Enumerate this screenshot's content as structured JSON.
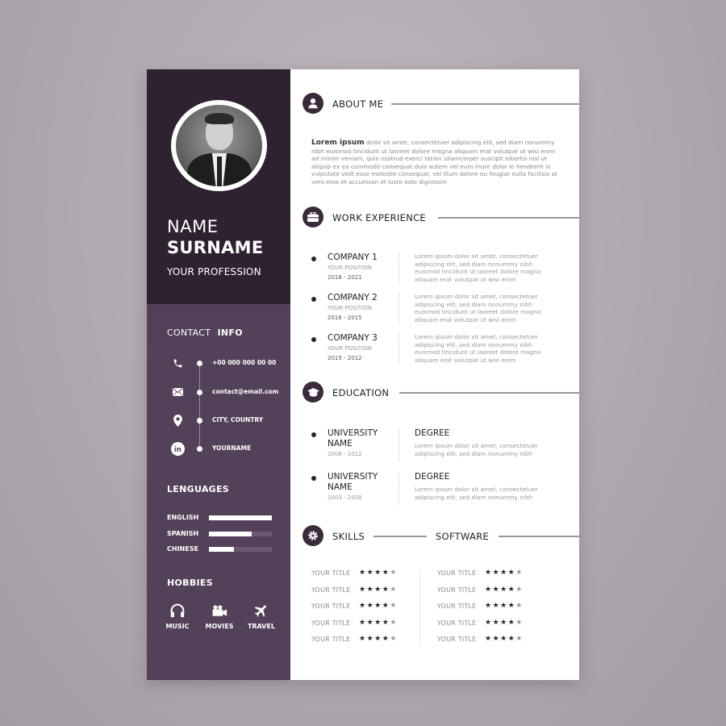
{
  "colors": {
    "sidebar_top": "#2f2230",
    "sidebar_bottom": "#524158",
    "accent_dark": "#3a2b3a",
    "background": "#b2acb2"
  },
  "profile": {
    "first_name": "NAME",
    "last_name": "SURNAME",
    "profession": "YOUR PROFESSION",
    "photo_icon": "portrait-photo"
  },
  "contact": {
    "heading_light": "CONTACT",
    "heading_bold": "INFO",
    "items": [
      {
        "icon": "phone-icon",
        "text": "+00 000 000 00 00"
      },
      {
        "icon": "envelope-icon",
        "text": "contact@email.com"
      },
      {
        "icon": "location-pin-icon",
        "text": "CITY, COUNTRY"
      },
      {
        "icon": "linkedin-icon",
        "text": "YOURNAME"
      }
    ]
  },
  "languages": {
    "heading": "LENGUAGES",
    "items": [
      {
        "name": "ENGLISH",
        "level": 1.0
      },
      {
        "name": "SPANISH",
        "level": 0.68
      },
      {
        "name": "CHINESE",
        "level": 0.4
      }
    ]
  },
  "hobbies": {
    "heading": "HOBBIES",
    "items": [
      {
        "icon": "headphones-icon",
        "label": "MUSIC"
      },
      {
        "icon": "video-camera-icon",
        "label": "MOVIES"
      },
      {
        "icon": "airplane-icon",
        "label": "TRAVEL"
      }
    ]
  },
  "about": {
    "title": "ABOUT ME",
    "icon": "user-icon",
    "lead": "Lorem ipsum",
    "text": "dolor sit amet, consectetuer adipiscing elit, sed diam nonummy nibh euismod tincidunt ut laoreet dolore magna aliquam erat volutpat ut wisi enim ad minim veniam, quis nostrud exerci tation ullamcorper suscipit lobortis nisl ut aliquip ex ea commodo consequat duis autem vel eum iriure dolor in hendrerit in vulputate velit esse molestie consequat, vel illum dolore eu feugiat nulla facilisis at vero eros et accumsan et iusto odio dignissim"
  },
  "work": {
    "title": "WORK EXPERIENCE",
    "icon": "briefcase-icon",
    "items": [
      {
        "company": "COMPANY 1",
        "position": "YOUR POSITION",
        "dates": "2018 - 2021",
        "desc": "Lorem ipsum dolor sit amet, consectetuer adipiscing elit, sed diam nonummy nibh euismod tincidunt ut laoreet dolore magna aliquam erat volutpat ut wisi enim"
      },
      {
        "company": "COMPANY 2",
        "position": "YOUR POSITION",
        "dates": "2018 - 2015",
        "desc": "Lorem ipsum dolor sit amet, consectetuer adipiscing elit, sed diam nonummy nibh euismod tincidunt ut laoreet dolore magna aliquam erat volutpat ut wisi enim"
      },
      {
        "company": "COMPANY 3",
        "position": "YOUR POSITION",
        "dates": "2015 - 2012",
        "desc": "Lorem ipsum dolor sit amet, consectetuer adipiscing elit, sed diam nonummy nibh euismod tincidunt ut laoreet dolore magna aliquam erat volutpat ut wisi enim"
      }
    ]
  },
  "education": {
    "title": "EDUCATION",
    "icon": "graduation-cap-icon",
    "items": [
      {
        "school": "UNIVERSITY NAME",
        "dates": "2008 - 2012",
        "degree": "DEGREE",
        "desc": "Lorem ipsum dolor sit amet, consectetuer adipiscing elit, sed diam nonummy nibh"
      },
      {
        "school": "UNIVERSITY NAME",
        "dates": "2003 - 2008",
        "degree": "DEGREE",
        "desc": "Lorem ipsum dolor sit amet, consectetuer adipiscing elit, sed diam nonummy nibh"
      }
    ]
  },
  "skills": {
    "title": "SKILLS",
    "icon": "gear-icon",
    "items": [
      {
        "title": "YOUR TITLE",
        "rating": 4,
        "max": 5
      },
      {
        "title": "YOUR TITLE",
        "rating": 4,
        "max": 5
      },
      {
        "title": "YOUR TITLE",
        "rating": 4,
        "max": 5
      },
      {
        "title": "YOUR TITLE",
        "rating": 4,
        "max": 5
      },
      {
        "title": "YOUR TITLE",
        "rating": 4,
        "max": 5
      }
    ]
  },
  "software": {
    "title": "SOFTWARE",
    "items": [
      {
        "title": "YOUR TITLE",
        "rating": 4,
        "max": 5
      },
      {
        "title": "YOUR TITLE",
        "rating": 4,
        "max": 5
      },
      {
        "title": "YOUR TITLE",
        "rating": 4,
        "max": 5
      },
      {
        "title": "YOUR TITLE",
        "rating": 4,
        "max": 5
      },
      {
        "title": "YOUR TITLE",
        "rating": 4,
        "max": 5
      }
    ]
  }
}
